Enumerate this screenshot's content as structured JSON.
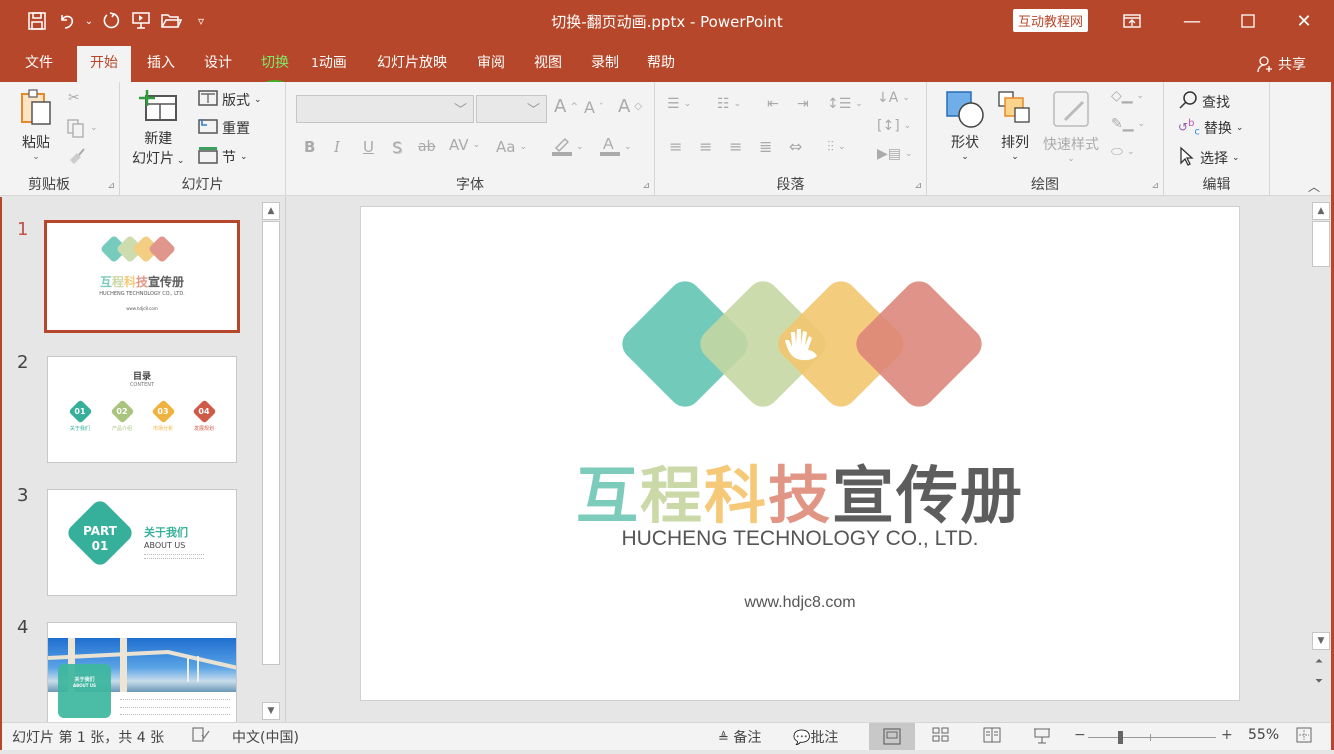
{
  "window": {
    "title": "切换-翻页动画.pptx  -  PowerPoint",
    "brand_badge": "互动教程网",
    "share_label": "共享"
  },
  "qat": [
    "save-icon",
    "undo-icon",
    "redo-icon",
    "present-from-start-icon",
    "open-icon",
    "customize-icon"
  ],
  "tabs": [
    {
      "label": "文件"
    },
    {
      "label": "开始",
      "active": true
    },
    {
      "label": "插入"
    },
    {
      "label": "设计"
    },
    {
      "label": "切换",
      "highlighted": true
    },
    {
      "label": "动画",
      "badge": "1"
    },
    {
      "label": "幻灯片放映"
    },
    {
      "label": "审阅"
    },
    {
      "label": "视图"
    },
    {
      "label": "录制"
    },
    {
      "label": "帮助"
    }
  ],
  "ribbon": {
    "clipboard": {
      "label": "剪贴板",
      "paste": "粘贴"
    },
    "slides": {
      "label": "幻灯片",
      "new_slide_line1": "新建",
      "new_slide_line2": "幻灯片",
      "layout": "版式",
      "reset": "重置",
      "section": "节"
    },
    "font": {
      "label": "字体",
      "font_name": "",
      "font_size": "",
      "bold": "B",
      "italic": "I",
      "underline": "U",
      "shadow": "S",
      "strike": "ab",
      "spacing": "AV",
      "case": "Aa",
      "color": "A"
    },
    "paragraph": {
      "label": "段落"
    },
    "drawing": {
      "label": "绘图",
      "shapes": "形状",
      "arrange": "排列",
      "quick_styles": "快速样式"
    },
    "editing": {
      "label": "编辑",
      "find": "查找",
      "replace": "替换",
      "select": "选择"
    }
  },
  "slides_pane": {
    "thumbs": [
      {
        "num": "1",
        "selected": true,
        "title": "互程科技宣传册",
        "subtitle": "HUCHENG TECHNOLOGY CO., LTD.",
        "url": "www.hdjc8.com"
      },
      {
        "num": "2",
        "title": "目录",
        "subtitle": "CONTENT",
        "items": [
          {
            "n": "01",
            "label": "关于我们",
            "color": "#36b09a"
          },
          {
            "n": "02",
            "label": "产品介绍",
            "color": "#a9c47f"
          },
          {
            "n": "03",
            "label": "市场分析",
            "color": "#f0b23e"
          },
          {
            "n": "04",
            "label": "发展规划",
            "color": "#d05a48"
          }
        ]
      },
      {
        "num": "3",
        "part": "PART",
        "part_num": "01",
        "title": "关于我们",
        "subtitle": "ABOUT US"
      },
      {
        "num": "4",
        "title": "关于我们",
        "subtitle": "ABOUT US"
      }
    ]
  },
  "slide": {
    "title_chars": [
      {
        "ch": "互",
        "color": "#7ccbbb"
      },
      {
        "ch": "程",
        "color": "#cbd9a8"
      },
      {
        "ch": "科",
        "color": "#f5c978"
      },
      {
        "ch": "技",
        "color": "#e09585"
      },
      {
        "ch": "宣",
        "color": "#5d5d5d"
      },
      {
        "ch": "传",
        "color": "#5d5d5d"
      },
      {
        "ch": "册",
        "color": "#5d5d5d"
      }
    ],
    "subtitle": "HUCHENG TECHNOLOGY CO., LTD.",
    "url": "www.hdjc8.com",
    "diamond_colors": [
      "#5fc3b2",
      "#c5d6a1",
      "#f2c56c",
      "#dc8477"
    ]
  },
  "status": {
    "slide_info": "幻灯片 第 1 张，共 4 张",
    "language": "中文(中国)",
    "notes": "备注",
    "comments": "批注",
    "zoom": "55%",
    "zoom_value_percent": 55
  },
  "colors": {
    "accent": "#b7472a",
    "highlight": "#3bb526"
  }
}
